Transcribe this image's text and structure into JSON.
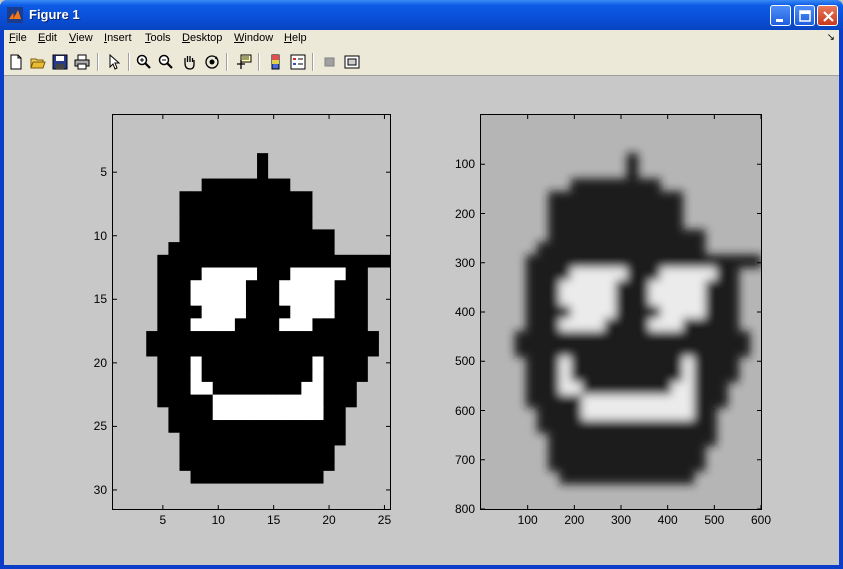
{
  "window": {
    "title": "Figure 1"
  },
  "menu": {
    "items": [
      "File",
      "Edit",
      "View",
      "Insert",
      "Tools",
      "Desktop",
      "Window",
      "Help"
    ]
  },
  "toolbar": {
    "icons": [
      "new-figure-icon",
      "open-file-icon",
      "save-icon",
      "print-icon",
      "pointer-icon",
      "zoom-in-icon",
      "zoom-out-icon",
      "pan-icon",
      "rotate-3d-icon",
      "data-cursor-icon",
      "colorbar-icon",
      "legend-icon",
      "hide-plot-tools-icon",
      "show-plot-tools-icon"
    ]
  },
  "chart_data": [
    {
      "type": "heatmap",
      "title": "",
      "colormap": "gray",
      "xlim": [
        0.5,
        25.5
      ],
      "ylim": [
        0.5,
        31.5
      ],
      "x_ticks": [
        5,
        10,
        15,
        20,
        25
      ],
      "y_ticks": [
        5,
        10,
        15,
        20,
        25,
        30
      ],
      "grid": false,
      "rows": [
        "xxxxxxxxxxxxxxxxxxxxxxxxx",
        "xxxxxxxxxxxxxxxxxxxxxxxxx",
        "xxxxxxxxxxxxxxxxxxxxxxxxx",
        "xxxxxxxxxxxxx#xxxxxxxxxxx",
        "xxxxxxxxxxxxx#xxxxxxxxxxx",
        "xxxxxxxx########xxxxxxxxx",
        "xxxxxx############xxxxxxx",
        "xxxxxx############xxxxxxx",
        "xxxxxx############xxxxxxx",
        "xxxxxx##############xxxxx",
        "xxxxx###############xxxxx",
        "xxxx######################",
        "xxxx####ooooo###ooooo##xx",
        "xxxx###ooooo###ooooo###xx",
        "xxxx###ooooo###ooooo###xx",
        "xxxx####oooo####oooo###xx",
        "xxxx###oooo####ooo#####xx",
        "xxx#####################xx",
        "xxx#####################xx",
        "xxxx###o##########o####xx",
        "xxxx###o##########o####xx",
        "xxxx###oo########oo###xxx",
        "xxxx#####oooooooooo###xxx",
        "xxxxx####oooooooooo##xxxx",
        "xxxxx################xxxx",
        "xxxxxx###############xxxx",
        "xxxxxx##############xxxxx",
        "xxxxxx##############xxxxx",
        "xxxxxxx############xxxxxx",
        "xxxxxxxxxxxxxxxxxxxxxxxxx",
        "xxxxxxxxxxxxxxxxxxxxxxxxx"
      ],
      "legend_values": {
        "x": 0.76,
        "#": 0.0,
        "o": 1.0
      }
    },
    {
      "type": "heatmap",
      "title": "",
      "colormap": "gray",
      "xlim": [
        0,
        600
      ],
      "ylim": [
        0,
        800
      ],
      "x_ticks": [
        100,
        200,
        300,
        400,
        500,
        600
      ],
      "y_ticks": [
        100,
        200,
        300,
        400,
        500,
        600,
        700,
        800
      ],
      "grid": false,
      "interpolation": "blurred"
    }
  ]
}
